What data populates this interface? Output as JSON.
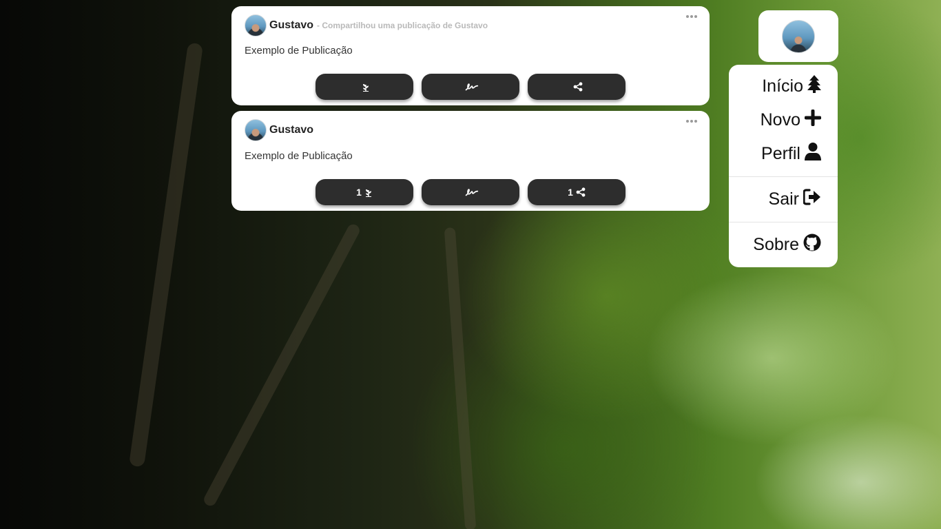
{
  "feed": {
    "posts": [
      {
        "author": "Gustavo",
        "shared_note": "- Compartilhou uma publicação de Gustavo",
        "text": "Exemplo de Publicação",
        "actions": {
          "like_count": "",
          "comment_count": "",
          "share_count": ""
        }
      },
      {
        "author": "Gustavo",
        "shared_note": "",
        "text": "Exemplo de Publicação",
        "actions": {
          "like_count": "1",
          "comment_count": "",
          "share_count": "1"
        }
      }
    ]
  },
  "nav": {
    "items": [
      {
        "label": "Início",
        "icon": "tree-icon"
      },
      {
        "label": "Novo",
        "icon": "plus-icon"
      },
      {
        "label": "Perfil",
        "icon": "user-icon"
      },
      {
        "label": "Sair",
        "icon": "sign-out-icon"
      },
      {
        "label": "Sobre",
        "icon": "github-icon"
      }
    ]
  },
  "colors": {
    "card": "#ffffff",
    "button": "#2d2d2d",
    "muted": "#b9b9b9"
  }
}
